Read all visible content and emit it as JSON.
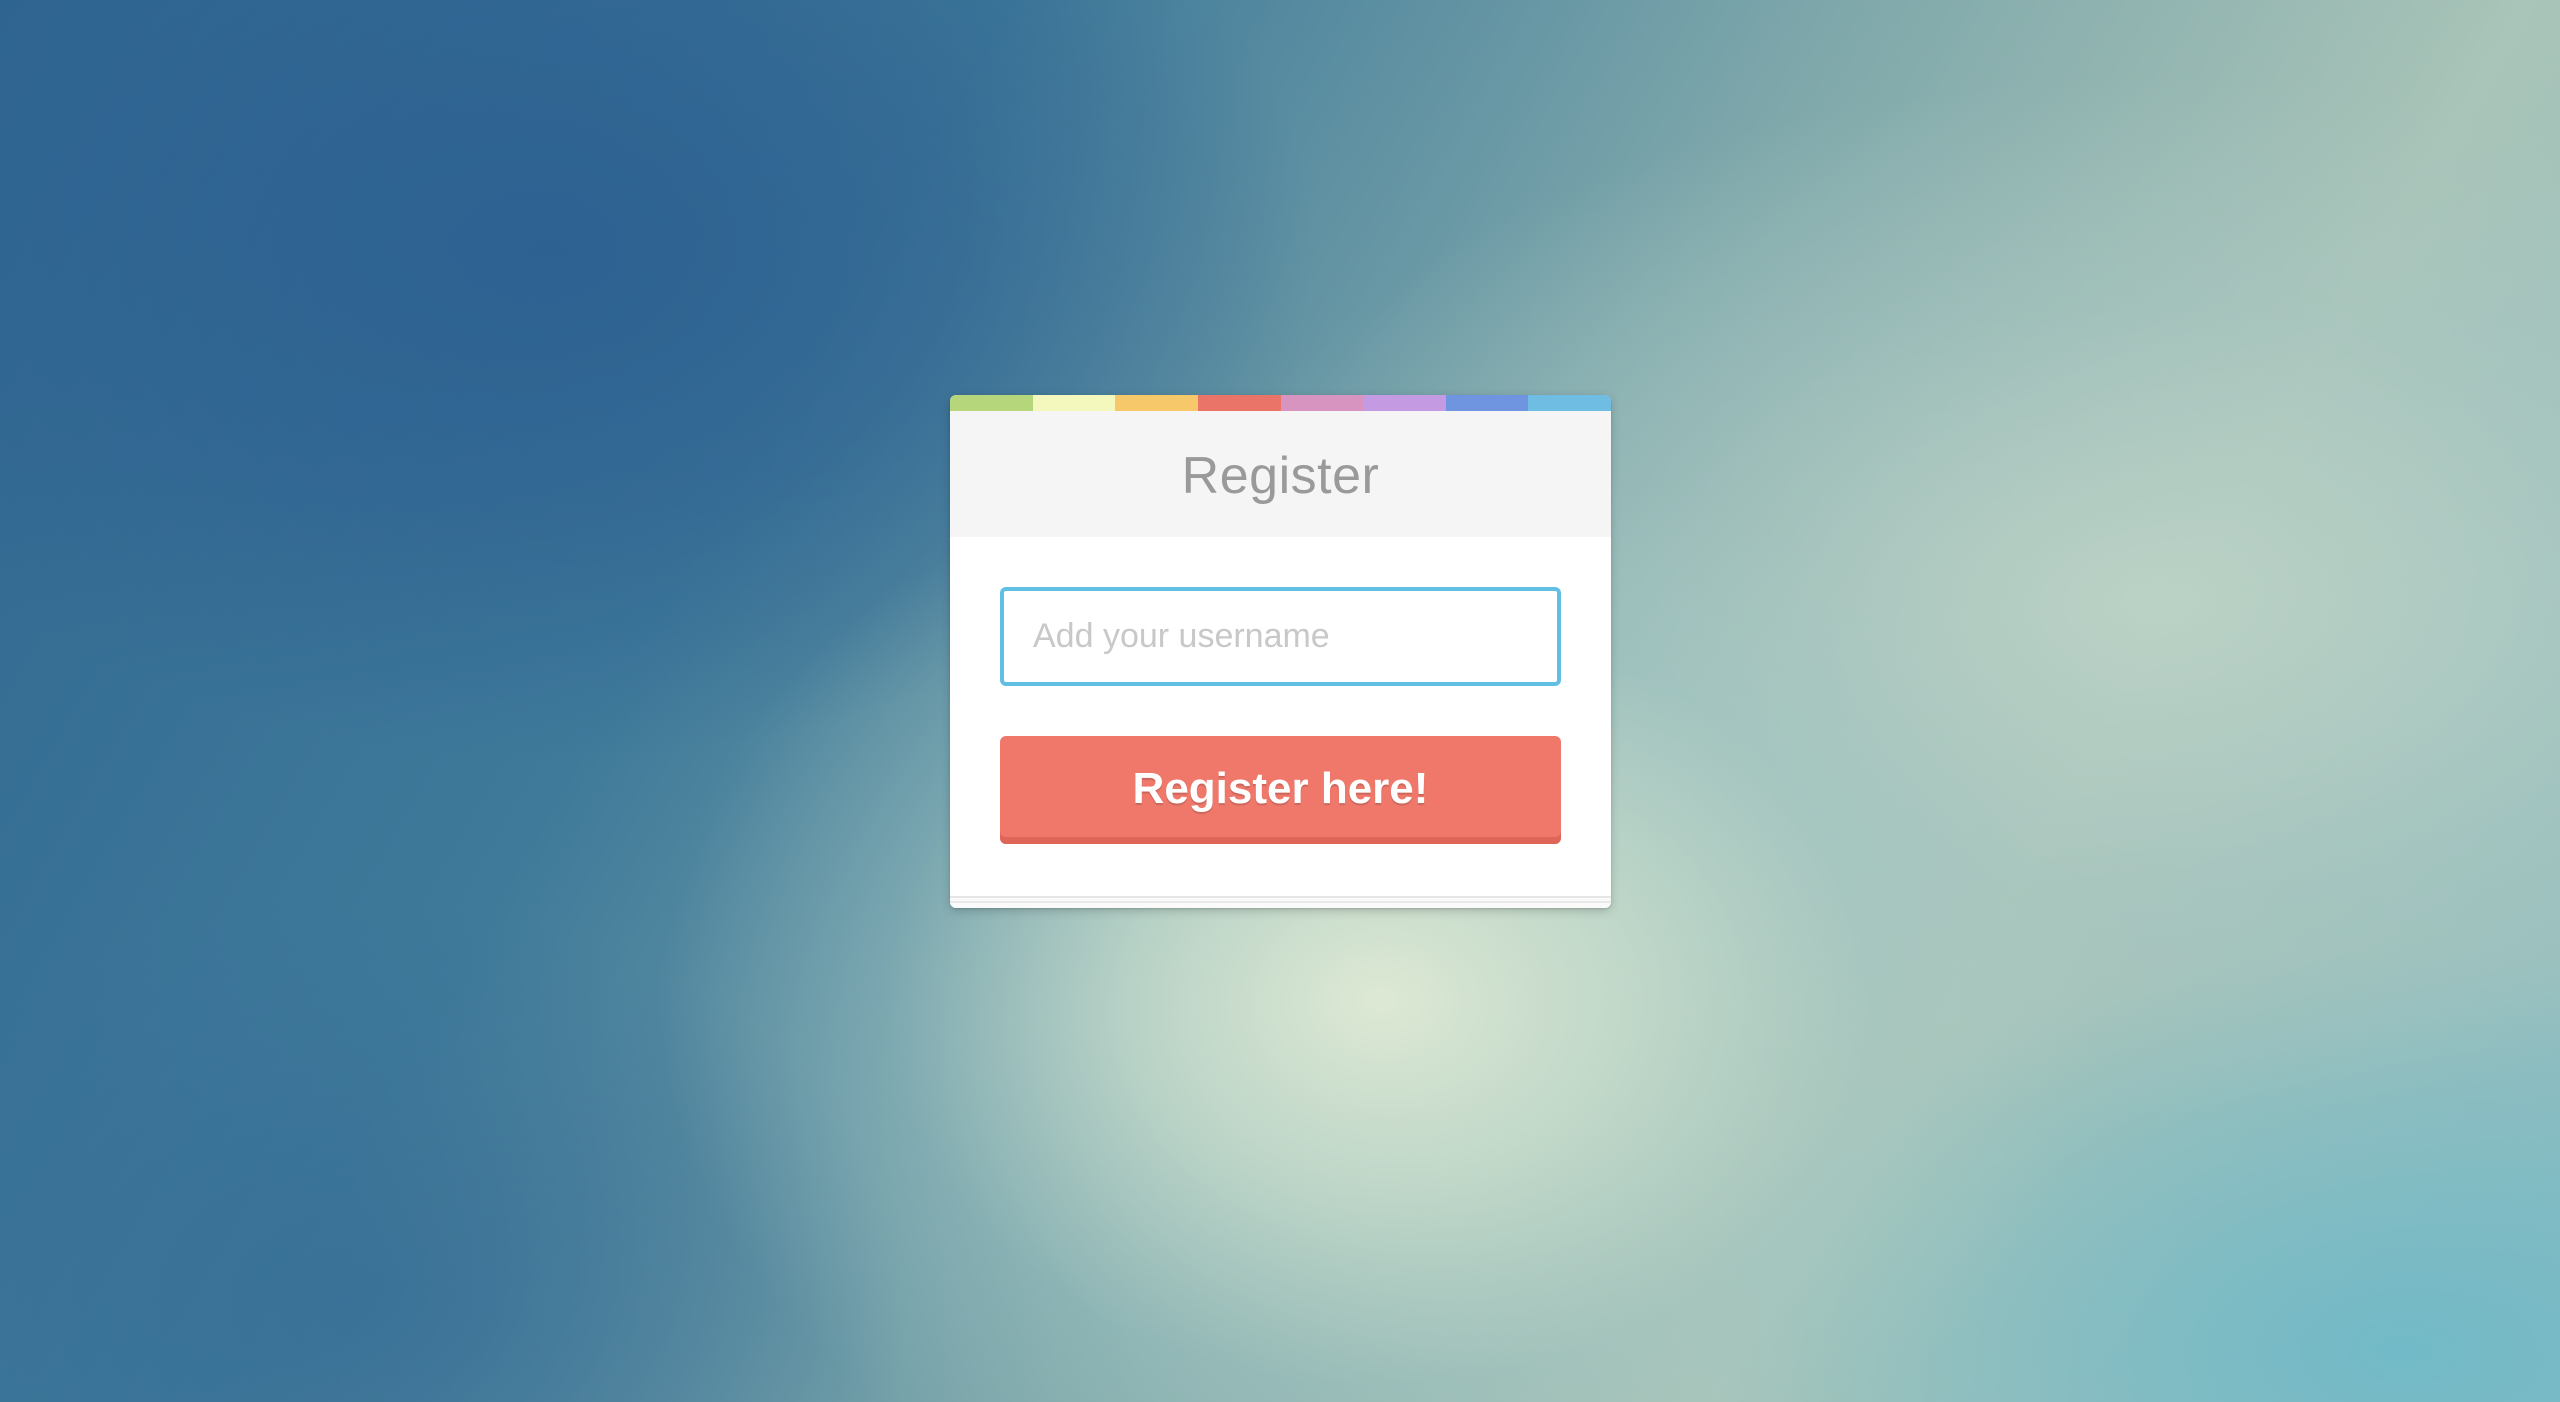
{
  "form": {
    "title": "Register",
    "username_placeholder": "Add your username",
    "username_value": "",
    "submit_label": "Register here!"
  },
  "colors": {
    "stripe": [
      "#b5d67b",
      "#f5f8bd",
      "#f7c86a",
      "#ea7468",
      "#d894c0",
      "#c49be3",
      "#6f95e0",
      "#6fbde3"
    ],
    "input_border": "#62bfe4",
    "button": "#ef786b",
    "header_bg": "#f5f5f5"
  }
}
